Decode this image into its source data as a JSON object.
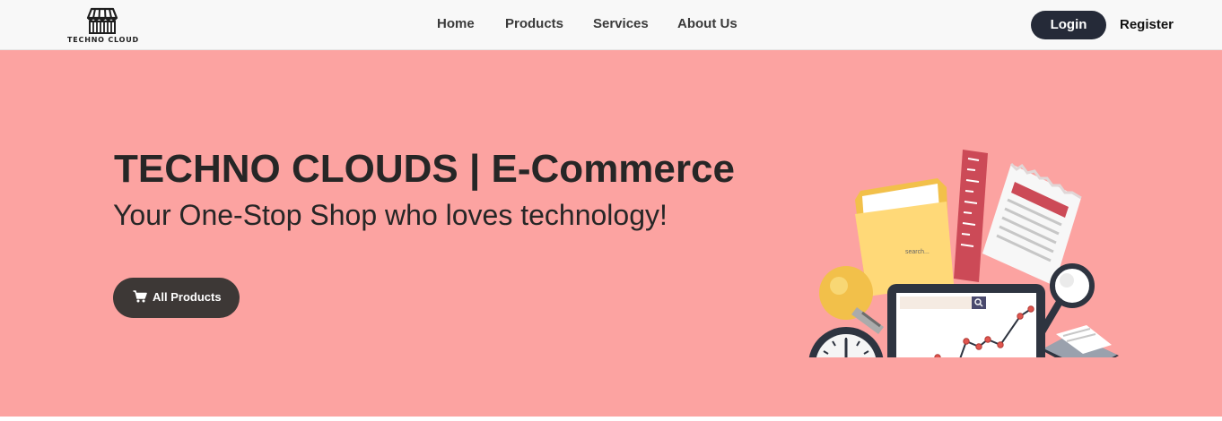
{
  "brand": {
    "logo_text": "TECHNO CLOUD"
  },
  "nav": {
    "items": [
      {
        "label": "Home"
      },
      {
        "label": "Products"
      },
      {
        "label": "Services"
      },
      {
        "label": "About Us"
      }
    ],
    "login_label": "Login",
    "register_label": "Register"
  },
  "hero": {
    "title": "TECHNO CLOUDS | E-Commerce",
    "subtitle": "Your One-Stop Shop who loves technology!",
    "cta_label": "All Products",
    "cta_icon": "cart-icon",
    "search_placeholder": "search..."
  },
  "colors": {
    "hero_background": "#fca3a1",
    "navbar_background": "#f8f8f8",
    "button_dark": "#252a38",
    "cta_background": "#3d3836"
  }
}
